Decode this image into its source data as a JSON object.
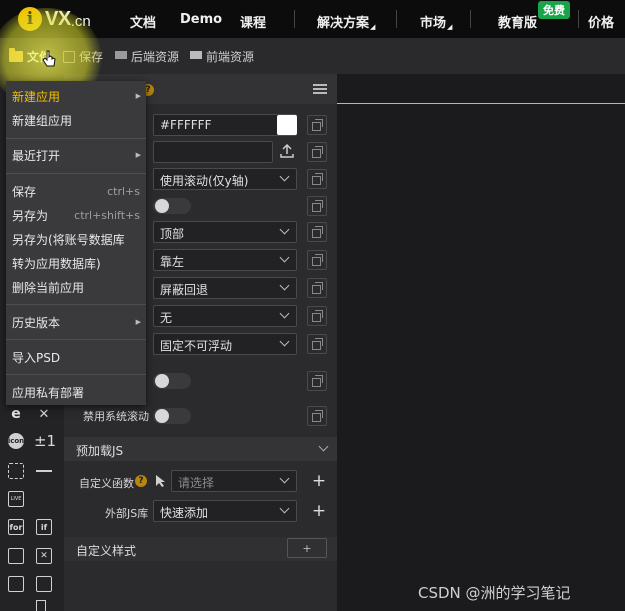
{
  "nav": {
    "logo_mark": "i",
    "logo_main": "VX",
    "logo_suffix": ".cn",
    "links": [
      "文档",
      "Demo",
      "课程",
      "解决方案",
      "市场",
      "教育版",
      "价格"
    ],
    "badge": "免费"
  },
  "toolbar": {
    "file": "文件",
    "save": "保存",
    "backend": "后端资源",
    "frontend": "前端资源"
  },
  "menu": {
    "items": [
      "新建应用",
      "新建组应用",
      "最近打开",
      "保存",
      "另存为",
      "另存为(将账号数据库",
      "转为应用数据库)",
      "删除当前应用",
      "历史版本",
      "导入PSD",
      "应用私有部署"
    ],
    "shortcuts": {
      "save": "ctrl+s",
      "save_as": "ctrl+shift+s"
    }
  },
  "props": {
    "color_value": "#FFFFFF",
    "scroll": "使用滚动(仅y轴)",
    "position": "顶部",
    "align": "靠左",
    "back": "屏蔽回退",
    "none": "无",
    "float": "固定不可浮动",
    "disable_scroll_label": "禁用系统滚动"
  },
  "preload": {
    "title": "预加载JS",
    "func_label": "自定义函数",
    "func_placeholder": "请选择",
    "lib_label": "外部JS库",
    "lib_value": "快速添加"
  },
  "custom_style": {
    "title": "自定义样式",
    "add": "+"
  },
  "leftstrip": {
    "pm": "±1",
    "icon_label": "icon",
    "live": "LIVE",
    "for": "for",
    "if": "if"
  },
  "watermark": "CSDN @洲的学习笔记",
  "colors": {
    "accent": "#f3c000",
    "badge": "#19a34a",
    "canvas_line": "#6fd3e0"
  }
}
